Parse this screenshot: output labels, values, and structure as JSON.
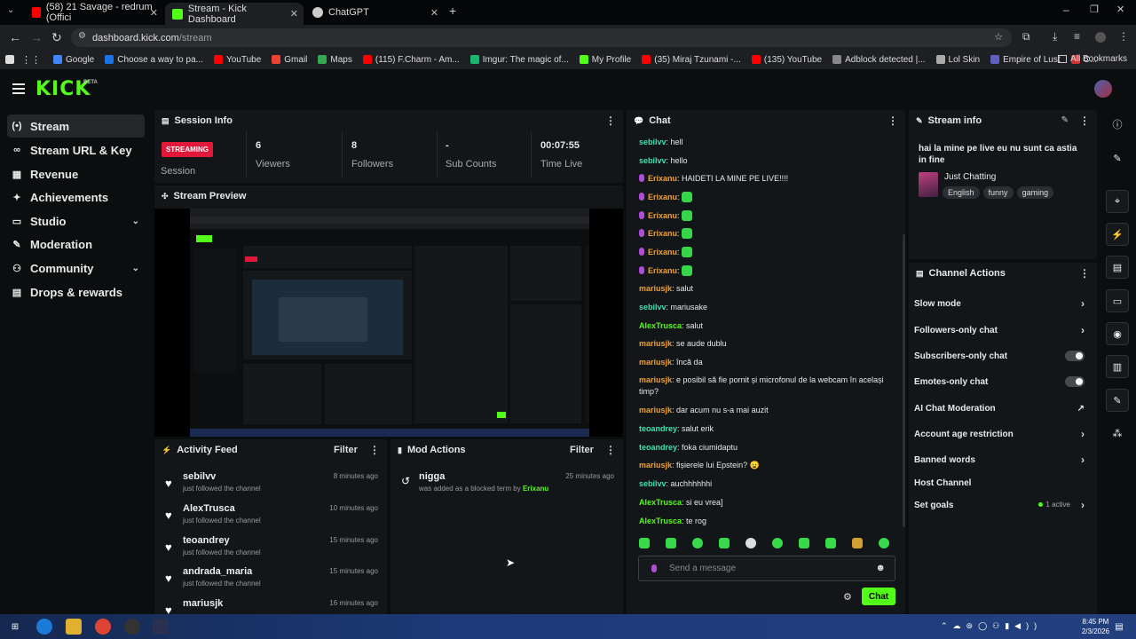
{
  "browser": {
    "tabs": [
      {
        "title": "(58) 21 Savage - redrum (Offici",
        "color": "#ff0000"
      },
      {
        "title": "Stream - Kick Dashboard",
        "color": "#53fc18"
      },
      {
        "title": "ChatGPT",
        "color": "#cccccc"
      }
    ],
    "url_host": "dashboard.kick.com",
    "url_path": "/stream",
    "bookmarks": [
      {
        "label": "Google",
        "color": "#4285f4"
      },
      {
        "label": "Choose a way to pa...",
        "color": "#1a73e8"
      },
      {
        "label": "YouTube",
        "color": "#ff0000"
      },
      {
        "label": "Gmail",
        "color": "#ea4335"
      },
      {
        "label": "Maps",
        "color": "#34a853"
      },
      {
        "label": "(115) F.Charm - Am...",
        "color": "#ff0000"
      },
      {
        "label": "Imgur: The magic of...",
        "color": "#1bb76e"
      },
      {
        "label": "My Profile",
        "color": "#53fc18"
      },
      {
        "label": "(35) Miraj Tzunami -...",
        "color": "#ff0000"
      },
      {
        "label": "(135) YouTube",
        "color": "#ff0000"
      },
      {
        "label": "Adblock detected |...",
        "color": "#888888"
      },
      {
        "label": "Lol Skin",
        "color": "#aaaaaa"
      },
      {
        "label": "Empire of Lust",
        "color": "#6060c0"
      },
      {
        "label": "C...",
        "color": "#cc3333"
      }
    ],
    "all_bookmarks": "All Bookmarks"
  },
  "app": {
    "logo": "KICK",
    "beta": "BETA"
  },
  "sidebar": {
    "items": [
      {
        "label": "Stream",
        "icon": "(•)"
      },
      {
        "label": "Stream URL & Key",
        "icon": "∞"
      },
      {
        "label": "Revenue",
        "icon": "▦"
      },
      {
        "label": "Achievements",
        "icon": "✦"
      },
      {
        "label": "Studio",
        "icon": "▭"
      },
      {
        "label": "Moderation",
        "icon": "✎"
      },
      {
        "label": "Community",
        "icon": "⚇"
      },
      {
        "label": "Drops & rewards",
        "icon": "▤"
      }
    ]
  },
  "session": {
    "title": "Session Info",
    "badge": "STREAMING",
    "badge_label": "Session",
    "stats": [
      {
        "value": "6",
        "label": "Viewers"
      },
      {
        "value": "8",
        "label": "Followers"
      },
      {
        "value": "-",
        "label": "Sub Counts"
      },
      {
        "value": "00:07:55",
        "label": "Time Live"
      }
    ]
  },
  "preview": {
    "title": "Stream Preview"
  },
  "activity": {
    "title": "Activity Feed",
    "filter": "Filter",
    "rows": [
      {
        "name": "sebilvv",
        "action": "just followed the channel",
        "time": "8 minutes ago"
      },
      {
        "name": "AlexTrusca",
        "action": "just followed the channel",
        "time": "10 minutes ago"
      },
      {
        "name": "teoandrey",
        "action": "just followed the channel",
        "time": "15 minutes ago"
      },
      {
        "name": "andrada_maria",
        "action": "just followed the channel",
        "time": "15 minutes ago"
      },
      {
        "name": "mariusjk",
        "action": "",
        "time": "16 minutes ago"
      }
    ]
  },
  "mod": {
    "title": "Mod Actions",
    "filter": "Filter",
    "rows": [
      {
        "term": "nigga",
        "desc": "was added as a blocked term by",
        "by": "Erixanu",
        "time": "25 minutes ago"
      }
    ]
  },
  "chat": {
    "title": "Chat",
    "messages": [
      {
        "user": "sebilvv",
        "color": "teal",
        "text": "hell"
      },
      {
        "user": "sebilvv",
        "color": "teal",
        "text": "hello"
      },
      {
        "user": "Erixanu",
        "color": "orange",
        "mic": true,
        "text": "HAIDETI LA MINE PE LIVE!!!!"
      },
      {
        "user": "Erixanu",
        "color": "orange",
        "mic": true,
        "emote": true,
        "text": ""
      },
      {
        "user": "Erixanu",
        "color": "orange",
        "mic": true,
        "emote": true,
        "text": ""
      },
      {
        "user": "Erixanu",
        "color": "orange",
        "mic": true,
        "emote": true,
        "text": ""
      },
      {
        "user": "Erixanu",
        "color": "orange",
        "mic": true,
        "emote": true,
        "text": ""
      },
      {
        "user": "Erixanu",
        "color": "orange",
        "mic": true,
        "emote": true,
        "text": ""
      },
      {
        "user": "mariusjk",
        "color": "orange",
        "text": "salut"
      },
      {
        "user": "sebilvv",
        "color": "teal",
        "text": "mariusake"
      },
      {
        "user": "AlexTrusca",
        "color": "green",
        "text": "salut"
      },
      {
        "user": "mariusjk",
        "color": "orange",
        "text": "se aude dublu"
      },
      {
        "user": "mariusjk",
        "color": "orange",
        "text": "încă da"
      },
      {
        "user": "mariusjk",
        "color": "orange",
        "text": "e posibil să fie pornit și microfonul de la webcam în același timp?"
      },
      {
        "user": "mariusjk",
        "color": "orange",
        "text": "dar acum nu s-a mai auzit"
      },
      {
        "user": "teoandrey",
        "color": "teal",
        "text": "salut erik"
      },
      {
        "user": "teoandrey",
        "color": "teal",
        "text": "foka ciumidaptu"
      },
      {
        "user": "mariusjk",
        "color": "orange",
        "text": "fișierele lui Epstein? 😦"
      },
      {
        "user": "sebilvv",
        "color": "teal",
        "text": "auchhhhhhi"
      },
      {
        "user": "AlexTrusca",
        "color": "green",
        "text": "si eu vrea]"
      },
      {
        "user": "AlexTrusca",
        "color": "green",
        "text": "te rog"
      }
    ],
    "input_placeholder": "Send a message",
    "send_label": "Chat"
  },
  "stream_info": {
    "title": "Stream info",
    "stream_title": "hai la mine pe live eu nu sunt ca astia in fine",
    "category": "Just Chatting",
    "tags": [
      "English",
      "funny",
      "gaming"
    ]
  },
  "channel_actions": {
    "title": "Channel Actions",
    "items": [
      {
        "label": "Slow mode",
        "control": "chevron"
      },
      {
        "label": "Followers-only chat",
        "control": "chevron"
      },
      {
        "label": "Subscribers-only chat",
        "control": "toggle",
        "on": false
      },
      {
        "label": "Emotes-only chat",
        "control": "toggle",
        "on": false
      },
      {
        "label": "AI Chat Moderation",
        "control": "external"
      },
      {
        "label": "Account age restriction",
        "control": "chevron"
      },
      {
        "label": "Banned words",
        "control": "chevron"
      },
      {
        "label": "Host Channel",
        "control": "none"
      },
      {
        "label": "Set goals",
        "control": "chevron",
        "badge": "1 active"
      }
    ]
  },
  "taskbar": {
    "time": "8:45 PM",
    "date": "2/3/2026"
  },
  "colors": {
    "accent": "#53fc18",
    "streaming": "#e1183a",
    "panel": "#131618",
    "background": "#0b0e0f"
  }
}
